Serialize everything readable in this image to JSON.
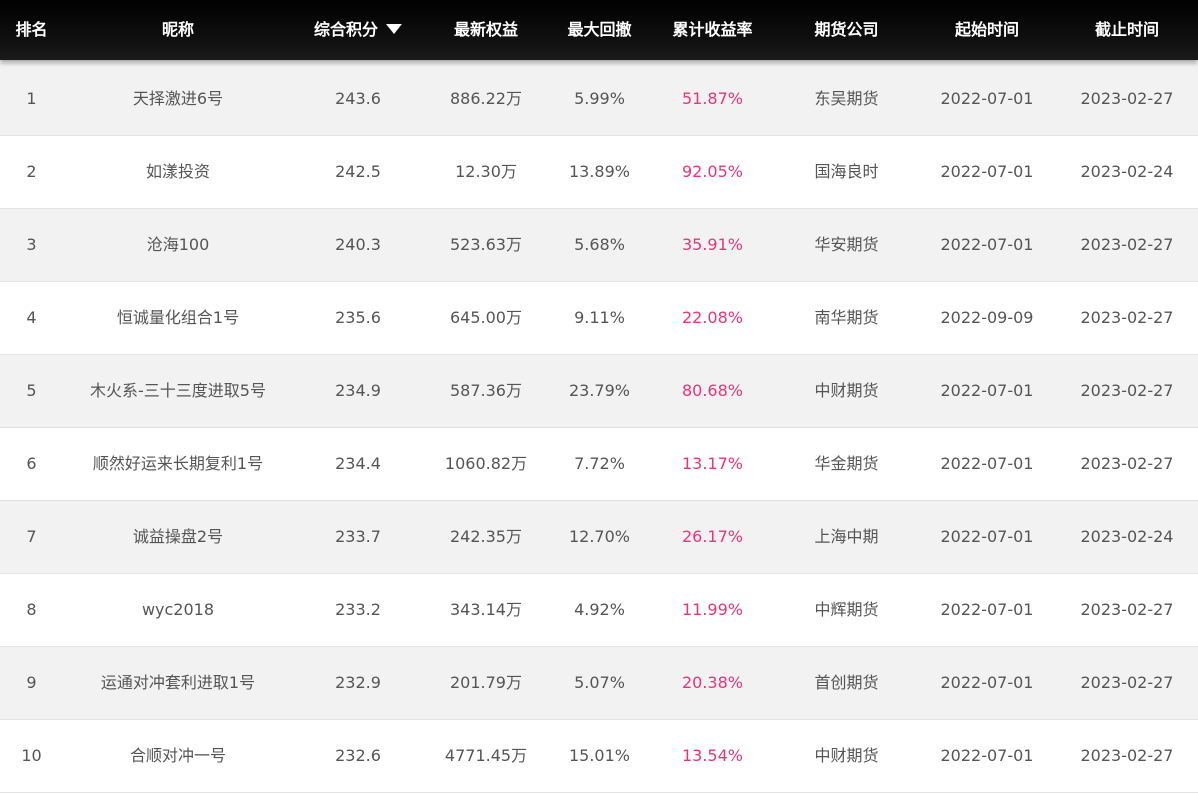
{
  "header": {
    "rank": "排名",
    "name": "昵称",
    "score": "综合积分",
    "equity": "最新权益",
    "max_drawdown": "最大回撤",
    "cumulative_return": "累计收益率",
    "company": "期货公司",
    "start_date": "起始时间",
    "end_date": "截止时间"
  },
  "colors": {
    "header_bg": "#111111",
    "header_text": "#ffffff",
    "row_alt_bg": "#f2f2f2",
    "return_text": "#e8357a",
    "body_text": "#555555"
  },
  "rows": [
    {
      "rank": "1",
      "name": "天择激进6号",
      "score": "243.6",
      "equity": "886.22万",
      "max_drawdown": "5.99%",
      "cumulative_return": "51.87%",
      "company": "东吴期货",
      "start_date": "2022-07-01",
      "end_date": "2023-02-27"
    },
    {
      "rank": "2",
      "name": "如漾投资",
      "score": "242.5",
      "equity": "12.30万",
      "max_drawdown": "13.89%",
      "cumulative_return": "92.05%",
      "company": "国海良时",
      "start_date": "2022-07-01",
      "end_date": "2023-02-24"
    },
    {
      "rank": "3",
      "name": "沧海100",
      "score": "240.3",
      "equity": "523.63万",
      "max_drawdown": "5.68%",
      "cumulative_return": "35.91%",
      "company": "华安期货",
      "start_date": "2022-07-01",
      "end_date": "2023-02-27"
    },
    {
      "rank": "4",
      "name": "恒诚量化组合1号",
      "score": "235.6",
      "equity": "645.00万",
      "max_drawdown": "9.11%",
      "cumulative_return": "22.08%",
      "company": "南华期货",
      "start_date": "2022-09-09",
      "end_date": "2023-02-27"
    },
    {
      "rank": "5",
      "name": "木火系-三十三度进取5号",
      "score": "234.9",
      "equity": "587.36万",
      "max_drawdown": "23.79%",
      "cumulative_return": "80.68%",
      "company": "中财期货",
      "start_date": "2022-07-01",
      "end_date": "2023-02-27"
    },
    {
      "rank": "6",
      "name": "顺然好运来长期复利1号",
      "score": "234.4",
      "equity": "1060.82万",
      "max_drawdown": "7.72%",
      "cumulative_return": "13.17%",
      "company": "华金期货",
      "start_date": "2022-07-01",
      "end_date": "2023-02-27"
    },
    {
      "rank": "7",
      "name": "诚益操盘2号",
      "score": "233.7",
      "equity": "242.35万",
      "max_drawdown": "12.70%",
      "cumulative_return": "26.17%",
      "company": "上海中期",
      "start_date": "2022-07-01",
      "end_date": "2023-02-24"
    },
    {
      "rank": "8",
      "name": "wyc2018",
      "score": "233.2",
      "equity": "343.14万",
      "max_drawdown": "4.92%",
      "cumulative_return": "11.99%",
      "company": "中辉期货",
      "start_date": "2022-07-01",
      "end_date": "2023-02-27"
    },
    {
      "rank": "9",
      "name": "运通对冲套利进取1号",
      "score": "232.9",
      "equity": "201.79万",
      "max_drawdown": "5.07%",
      "cumulative_return": "20.38%",
      "company": "首创期货",
      "start_date": "2022-07-01",
      "end_date": "2023-02-27"
    },
    {
      "rank": "10",
      "name": "合顺对冲一号",
      "score": "232.6",
      "equity": "4771.45万",
      "max_drawdown": "15.01%",
      "cumulative_return": "13.54%",
      "company": "中财期货",
      "start_date": "2022-07-01",
      "end_date": "2023-02-27"
    }
  ]
}
